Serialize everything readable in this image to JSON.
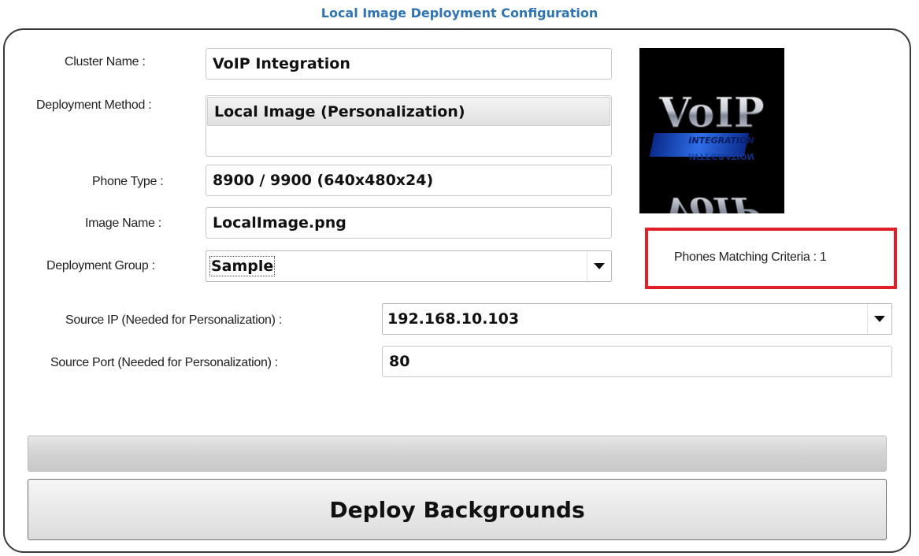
{
  "caption": "Local Image Deployment Configuration",
  "form": {
    "cluster_name": {
      "label": "Cluster Name :",
      "value": "VoIP Integration"
    },
    "deployment_method": {
      "label": "Deployment Method :",
      "options": [
        "Local Image (Personalization)"
      ]
    },
    "phone_type": {
      "label": "Phone Type :",
      "value": "8900 / 9900 (640x480x24)"
    },
    "image_name": {
      "label": "Image Name :",
      "value": "LocalImage.png"
    },
    "deployment_group": {
      "label": "Deployment Group :",
      "value": "Sample"
    },
    "source_ip": {
      "label": "Source IP (Needed for Personalization) :",
      "value": "192.168.10.103"
    },
    "source_port": {
      "label": "Source Port (Needed for Personalization) :",
      "value": "80"
    }
  },
  "preview": {
    "logo_text": "VoIP",
    "logo_band": "INTEGRATION",
    "icon": "voip-integration-logo"
  },
  "matching": {
    "text": "Phones Matching Criteria : 1"
  },
  "progress": {
    "value": 0
  },
  "actions": {
    "deploy_label": "Deploy Backgrounds"
  },
  "colors": {
    "caption": "#2e74b5",
    "highlight": "#e01f26"
  }
}
